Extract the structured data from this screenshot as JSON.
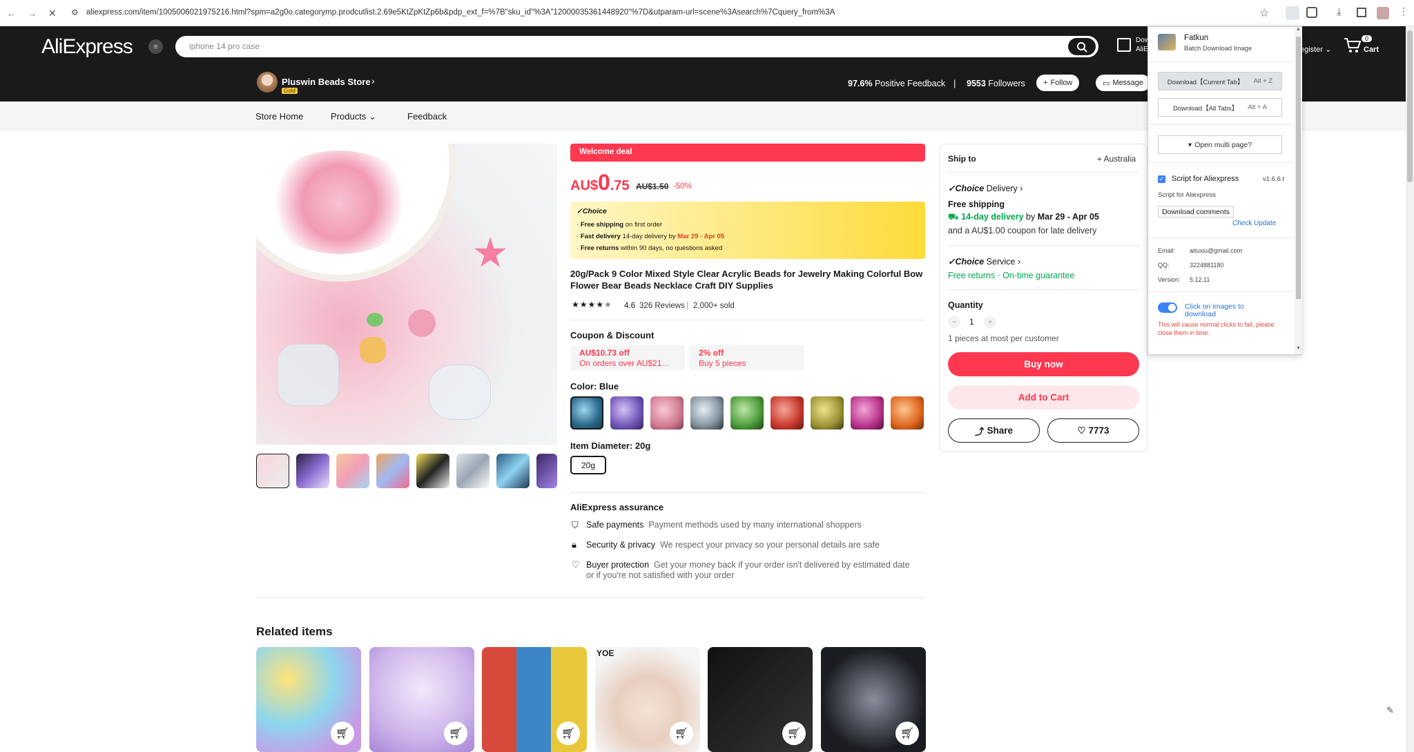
{
  "browser": {
    "url": "aliexpress.com/item/1005006021975216.html?spm=a2g0o.categorymp.prodcutlist.2.69e5KtZpKtZp6b&pdp_ext_f=%7B\"sku_id\"%3A\"12000035361448920\"%7D&utparam-url=scene%3Asearch%7Cquery_from%3A"
  },
  "header": {
    "logo": "AliExpress",
    "search_placeholder": "iphone 14 pro case",
    "download_partial": "Dow",
    "download_partial2": "AliE",
    "register": "egister",
    "cart_count": "0",
    "cart_label": "Cart"
  },
  "store": {
    "name": "Pluswin Beads Store",
    "badge": "Gold",
    "feedback_pct": "97.6%",
    "feedback_label": "Positive Feedback",
    "followers_count": "9553",
    "followers_label": "Followers",
    "follow": "Follow",
    "message": "Message"
  },
  "nav": {
    "home": "Store Home",
    "products": "Products",
    "feedback": "Feedback"
  },
  "product": {
    "welcome": "Welcome deal",
    "currency": "AU$",
    "price_int": "0",
    "price_dec": ".75",
    "old_price": "AU$1.50",
    "discount": "-50%",
    "choice_label": "Choice",
    "choice_lines": [
      {
        "bold": "Free shipping",
        "rest": " on first order"
      },
      {
        "bold": "Fast delivery",
        "rest": " 14-day delivery by ",
        "red": "Mar 29 - Apr 05"
      },
      {
        "bold": "Free returns",
        "rest": "  within 90 days, no questions asked"
      }
    ],
    "title_line1": "20g/Pack 9 Color Mixed Style Clear Acrylic Beads for Jewelry Making Colorful Bow",
    "title_line2": "Flower Bear Beads Necklace Craft DIY Supplies",
    "rating": "4.6",
    "reviews": "326 Reviews",
    "sold": "2,000+ sold",
    "rating_value": 4.6,
    "coupon_heading": "Coupon & Discount",
    "coupons": [
      {
        "title": "AU$10.73 off",
        "sub": "On orders over AU$21..."
      },
      {
        "title": "2% off",
        "sub": "Buy 5 pieces"
      }
    ],
    "color_label": "Color: Blue",
    "diameter_label": "Item Diameter: 20g",
    "diameter_option": "20g",
    "assurance_heading": "AliExpress assurance",
    "assurance": [
      {
        "title": "Safe payments",
        "desc": "Payment methods used by many international shoppers"
      },
      {
        "title": "Security & privacy",
        "desc": "We respect your privacy so your personal details are safe"
      },
      {
        "title": "Buyer protection",
        "desc": "Get your money back if your order isn't delivered by estimated date",
        "desc2": "or if you're not satisfied with your order"
      }
    ],
    "related_heading": "Related items"
  },
  "sidebar": {
    "ship_to": "Ship to",
    "country": "Australia",
    "choice_delivery": "Delivery",
    "choice_word": "Choice",
    "free_shipping": "Free shipping",
    "delivery_days": "14-day delivery",
    "by": " by ",
    "delivery_dates": "Mar 29 - Apr 05",
    "coupon_note": "and a AU$1.00 coupon for late delivery",
    "choice_service": "Service",
    "free_returns": "Free returns · On-time guarantee",
    "quantity_label": "Quantity",
    "quantity": "1",
    "qty_note": "1 pieces at most per customer",
    "buy_now": "Buy now",
    "add_to_cart": "Add to Cart",
    "share": "Share",
    "wishlist_count": "7773"
  },
  "fatkun": {
    "name": "Fatkun",
    "subtitle": "Batch Download Image",
    "btn_current": "Download【Current Tab】",
    "btn_current_key": "Alt + Z",
    "btn_all": "Download【All Tabs】",
    "btn_all_key": "Alt + A",
    "open_multi": "Open multi page?",
    "script_name": "Script for Aliexpress",
    "script_version": "v1.6.6.t",
    "script_sub": "Script for Aliexpress",
    "download_comments": "Download comments",
    "check_update": "Check Update",
    "email_label": "Email:",
    "email": "aituxiu@gmail.com",
    "qq_label": "QQ:",
    "qq": "3224881180",
    "version_label": "Version:",
    "version": "5.12.11",
    "click_images": "Click on images to download",
    "warning": "This will cause normal clicks to fail, please close them in time."
  },
  "colors": {
    "accent": "#fd384f",
    "header_bg": "#1a1a1a",
    "choice_yellow": "#fddb3a",
    "green": "#00a94f"
  }
}
